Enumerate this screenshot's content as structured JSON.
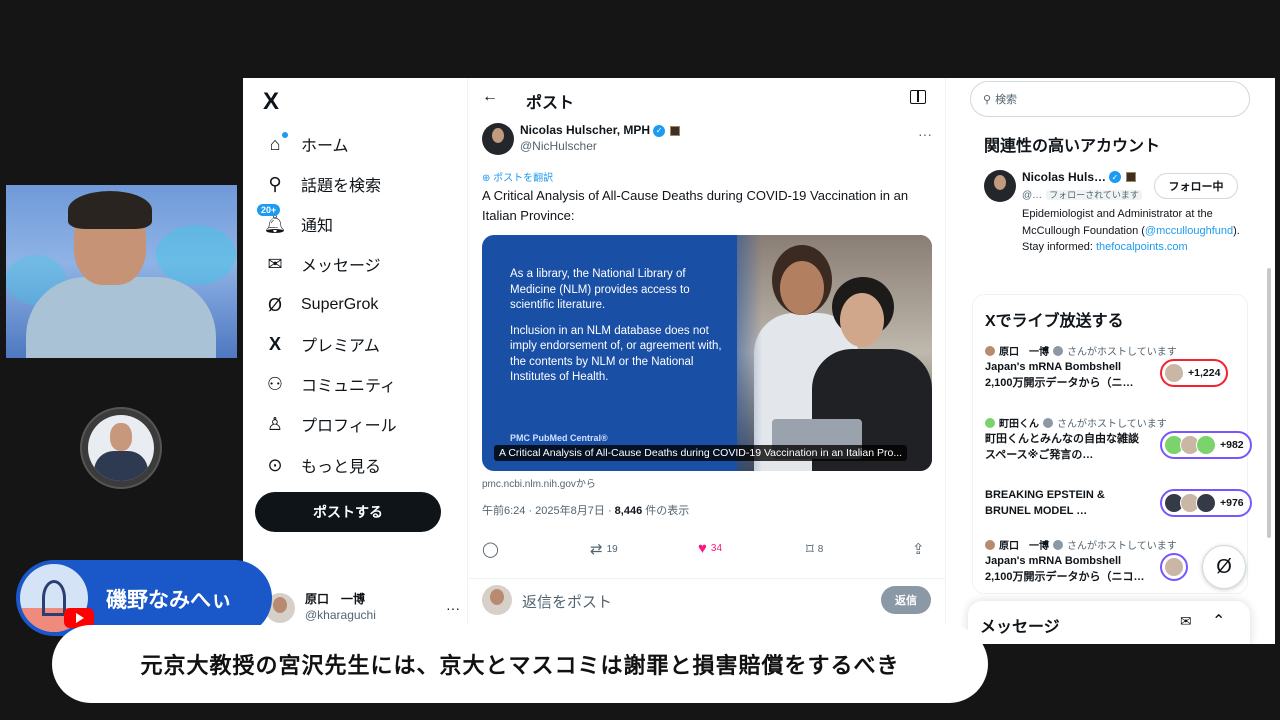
{
  "nav": {
    "logo": "X",
    "items": [
      {
        "label": "ホーム",
        "icon": "home-icon"
      },
      {
        "label": "話題を検索",
        "icon": "search-icon"
      },
      {
        "label": "通知",
        "icon": "bell-icon",
        "badge": "20+"
      },
      {
        "label": "メッセージ",
        "icon": "mail-icon"
      },
      {
        "label": "SuperGrok",
        "icon": "grok-icon"
      },
      {
        "label": "プレミアム",
        "icon": "x-icon"
      },
      {
        "label": "コミュニティ",
        "icon": "people-icon"
      },
      {
        "label": "プロフィール",
        "icon": "person-icon"
      },
      {
        "label": "もっと見る",
        "icon": "more-circle-icon"
      }
    ],
    "post_button": "ポストする",
    "account": {
      "name": "原口　一博",
      "handle": "@kharaguchi",
      "more": "···"
    }
  },
  "main": {
    "back": "←",
    "title": "ポスト",
    "author": {
      "name": "Nicolas Hulscher, MPH",
      "handle": "@NicHulscher",
      "menu": "···"
    },
    "translate": "ポストを翻訳",
    "text": "A Critical Analysis of All-Cause Deaths during COVID-19 Vaccination in an Italian Province:",
    "card": {
      "para1": "As a library, the National Library of Medicine (NLM) provides access to scientific literature.",
      "para2": "Inclusion in an NLM database does not imply endorsement of, or agreement with, the contents by NLM or the National Institutes of Health.",
      "logo": "PMC PubMed Central®",
      "caption": "A Critical Analysis of All-Cause Deaths during COVID-19 Vaccination in an Italian Pro..."
    },
    "source": "pmc.ncbi.nlm.nih.govから",
    "meta_time": "午前6:24 · 2025年8月7日 · ",
    "meta_views": "8,446",
    "meta_views_suffix": " 件の表示",
    "actions": {
      "reply": "",
      "repost": "19",
      "like": "34",
      "bookmark": "8",
      "share": ""
    },
    "reply_placeholder": "返信をポスト",
    "reply_button": "返信"
  },
  "right": {
    "search_placeholder": "検索",
    "related_title": "関連性の高いアカウント",
    "related": {
      "name": "Nicolas Huls…",
      "handle": "@…",
      "tag": "フォローされています",
      "follow_button": "フォロー中",
      "bio_pre": "Epidemiologist and Administrator at the McCullough Foundation (",
      "bio_link1": "@mcculloughfund",
      "bio_mid": "). Stay informed: ",
      "bio_link2": "thefocalpoints.com"
    },
    "live_title": "Xでライブ放送する",
    "live": [
      {
        "host": "原口　一博",
        "host_suffix": "さんがホストしています",
        "title": "Japan's mRNA Bombshell 2,100万開示データから（ニ…",
        "count": "+1,224"
      },
      {
        "host": "町田くん",
        "host_suffix": "さんがホストしています",
        "title": "町田くんとみんなの自由な雑談スペース※ご発言の…",
        "count": "+982"
      },
      {
        "host": "",
        "host_suffix": "",
        "title": "BREAKING EPSTEIN & BRUNEL MODEL …",
        "count": "+976"
      },
      {
        "host": "原口　一博",
        "host_suffix": "さんがホストしています",
        "title": "Japan's mRNA Bombshell 2,100万開示データから（ニコ…",
        "count": ""
      }
    ],
    "messages_title": "メッセージ"
  },
  "overlay": {
    "presenter_name": "磯野なみへぃ",
    "subtitle": "元京大教授の宮沢先生には、京大とマスコミは謝罪と損害賠償をするべき"
  },
  "colors": {
    "accent": "#1d9bf0",
    "like": "#f91880",
    "nameplate": "#1a57c9"
  }
}
